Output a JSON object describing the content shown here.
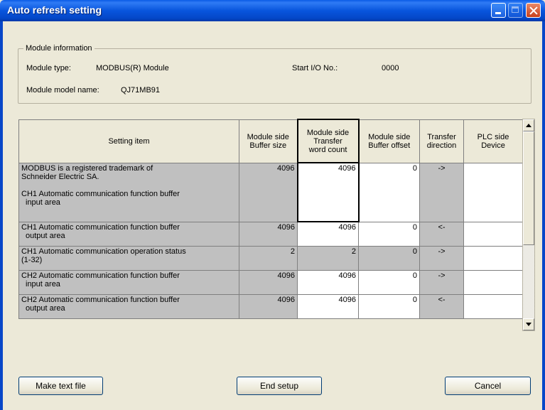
{
  "window": {
    "title": "Auto refresh setting"
  },
  "module_info": {
    "legend": "Module information",
    "type_label": "Module type:",
    "type_value": "MODBUS(R) Module",
    "start_io_label": "Start I/O No.:",
    "start_io_value": "0000",
    "model_label": "Module model name:",
    "model_value": "QJ71MB91"
  },
  "table": {
    "headers": {
      "setting_item": "Setting item",
      "buffer_size": [
        "Module side",
        "Buffer size"
      ],
      "transfer_count": [
        "Module side",
        "Transfer",
        "word count"
      ],
      "buffer_offset": [
        "Module side",
        "Buffer offset"
      ],
      "direction": [
        "Transfer",
        "direction"
      ],
      "plc_device": [
        "PLC side",
        "Device"
      ]
    },
    "rows": [
      {
        "item": [
          "MODBUS is a registered trademark of",
          "Schneider Electric SA.",
          "",
          "CH1 Automatic communication function buffer",
          "input area"
        ],
        "buffer_size": "4096",
        "transfer_count": "4096",
        "offset": "0",
        "direction": "->",
        "device": ""
      },
      {
        "item": [
          "CH1 Automatic communication function buffer",
          "output area"
        ],
        "buffer_size": "4096",
        "transfer_count": "4096",
        "offset": "0",
        "direction": "<-",
        "device": ""
      },
      {
        "item": [
          "CH1 Automatic communication operation status",
          "(1-32)"
        ],
        "buffer_size": "2",
        "transfer_count": "2",
        "offset": "0",
        "direction": "->",
        "device": ""
      },
      {
        "item": [
          "CH2 Automatic communication function buffer",
          "input area"
        ],
        "buffer_size": "4096",
        "transfer_count": "4096",
        "offset": "0",
        "direction": "->",
        "device": ""
      },
      {
        "item": [
          "CH2 Automatic communication function buffer",
          "output area"
        ],
        "buffer_size": "4096",
        "transfer_count": "4096",
        "offset": "0",
        "direction": "<-",
        "device": ""
      }
    ]
  },
  "buttons": {
    "make_text": "Make text file",
    "end_setup": "End setup",
    "cancel": "Cancel"
  },
  "icons": [
    "minimize-icon",
    "maximize-icon",
    "close-icon",
    "scroll-up-arrow-icon",
    "scroll-down-arrow-icon"
  ],
  "colors": {
    "titlebar": "#0855dd",
    "dialog_bg": "#ece9d8",
    "readonly_cell": "#c0c0c0",
    "editable_cell": "#ffffff"
  }
}
